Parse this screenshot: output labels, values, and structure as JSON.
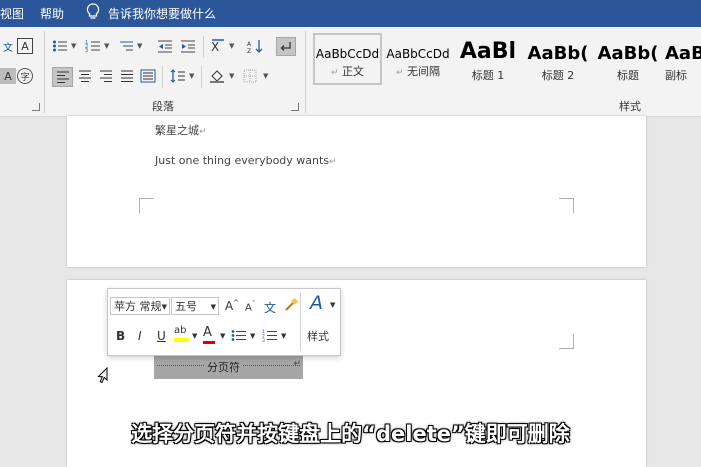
{
  "tabs": {
    "view": "视图",
    "help": "帮助",
    "tell_me": "告诉我你想要做什么"
  },
  "ribbon": {
    "paragraph_label": "段落",
    "styles_label": "样式",
    "font_icons": {
      "pinyin": "文",
      "border_char": "A",
      "shade_char": "A",
      "circle_char": "字"
    },
    "styles": [
      {
        "preview": "AaBbCcDd",
        "name": "正文"
      },
      {
        "preview": "AaBbCcDd",
        "name": "无间隔"
      },
      {
        "preview": "AaBl",
        "name": "标题 1"
      },
      {
        "preview": "AaBb(",
        "name": "标题 2"
      },
      {
        "preview": "AaBb(",
        "name": "标题"
      },
      {
        "preview": "AaB",
        "name": "副标"
      }
    ]
  },
  "document": {
    "line1": "繁星之城",
    "line2": "Just one thing everybody wants",
    "page_break": "分页符"
  },
  "mini_toolbar": {
    "font_name": "苹方 常规",
    "font_size": "五号",
    "styles_label": "样式",
    "bold": "B",
    "italic": "I",
    "underline": "U",
    "highlight": "ab",
    "font_color": "A",
    "grow": "A",
    "shrink": "A",
    "wen": "文",
    "style_a": "A"
  },
  "caption": "选择分页符并按键盘上的“delete”键即可删除",
  "colors": {
    "accent": "#2b579a",
    "font_color_bar": "#e00000",
    "highlight_bar": "#ffff00",
    "page_break_bg": "#a6a6a6"
  }
}
